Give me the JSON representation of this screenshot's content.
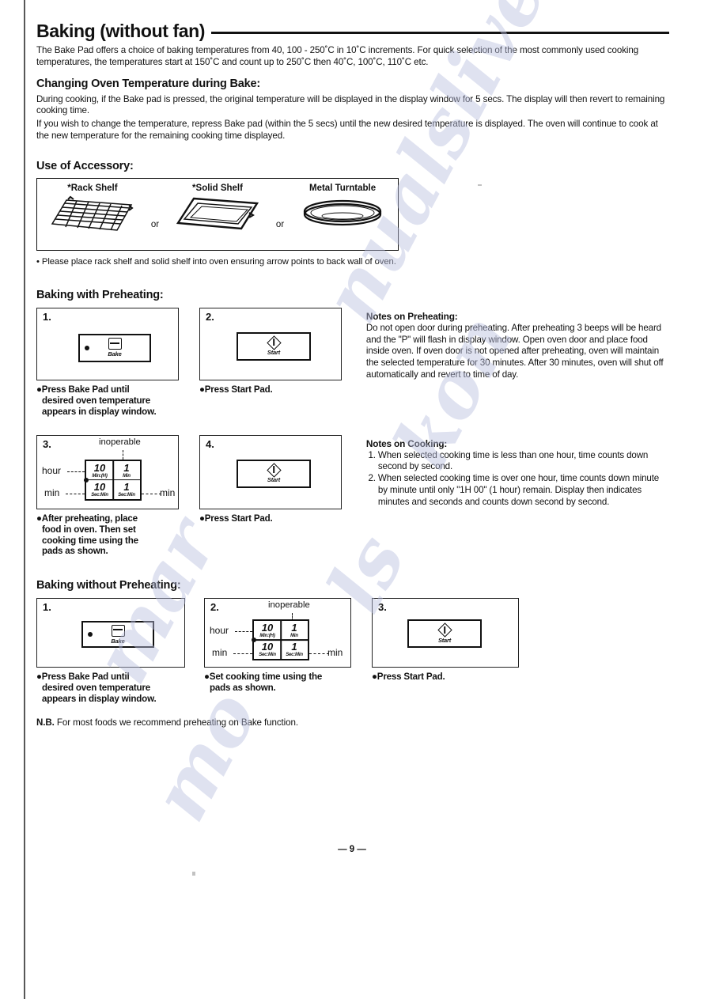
{
  "document": {
    "title": "Baking (without fan)",
    "page_number": "— 9 —"
  },
  "intro": {
    "paragraph": "The Bake Pad offers a choice of baking temperatures from 40, 100 - 250˚C in 10˚C increments. For quick selection of the most commonly used cooking temperatures, the temperatures start at 150˚C and count up to 250˚C then 40˚C, 100˚C, 110˚C etc."
  },
  "changing_temp": {
    "heading": "Changing Oven Temperature during Bake:",
    "paragraph_1": "During cooking, if the Bake pad is pressed, the original temperature will be displayed in the display window for 5 secs. The display will then revert to remaining cooking time.",
    "paragraph_2": "If you wish to change the temperature, repress Bake pad (within the 5 secs) until the new desired temperature is displayed. The oven will continue to cook at the new temperature for the remaining cooking time displayed."
  },
  "accessory": {
    "heading": "Use of Accessory:",
    "items": [
      {
        "label": "*Rack Shelf",
        "icon": "rack-shelf-icon"
      },
      {
        "label": "*Solid Shelf",
        "icon": "solid-shelf-icon"
      },
      {
        "label": "Metal Turntable",
        "icon": "metal-turntable-icon"
      }
    ],
    "separator": "or",
    "footnote": "• Please place rack shelf and solid shelf into oven ensuring arrow points to back wall of oven."
  },
  "with_preheating": {
    "heading": "Baking with Preheating:",
    "steps": [
      {
        "number": "1.",
        "pad": {
          "type": "bake",
          "caption": "Bake",
          "icon": "oven-icon"
        },
        "caption_lines": [
          "●Press Bake Pad until",
          "desired oven temperature",
          "appears in display window."
        ]
      },
      {
        "number": "2.",
        "pad": {
          "type": "start",
          "caption": "Start",
          "icon": "start-diamond-icon"
        },
        "caption_lines": [
          "●Press Start Pad."
        ]
      },
      {
        "number": "3.",
        "pad": {
          "type": "matrix"
        },
        "caption_lines": [
          "●After preheating, place",
          "food in oven. Then set",
          "cooking time using the",
          "pads as shown."
        ]
      },
      {
        "number": "4.",
        "pad": {
          "type": "start",
          "caption": "Start",
          "icon": "start-diamond-icon"
        },
        "caption_lines": [
          "●Press Start Pad."
        ]
      }
    ]
  },
  "time_matrix": {
    "inoperable_label": "inoperable",
    "row_label_top": "hour",
    "row_label_bottom": "min",
    "right_label": "min",
    "cells": [
      {
        "value": "10",
        "sub": "Min:(H)"
      },
      {
        "value": "1",
        "sub": "Min"
      },
      {
        "value": "10",
        "sub": "Sec:Min"
      },
      {
        "value": "1",
        "sub": "Sec:Min"
      }
    ]
  },
  "notes_preheating": {
    "title": "Notes on Preheating:",
    "body": "Do not open door during preheating. After preheating 3 beeps will be heard and the \"P\" will flash in display window. Open oven door and place food inside oven. If oven door is not opened after preheating, oven will maintain the selected temperature for 30 minutes. After 30 minutes, oven will shut off automatically and revert to time of day."
  },
  "notes_cooking": {
    "title": "Notes on Cooking:",
    "items": [
      "When selected cooking time is less than one hour, time counts down second by second.",
      "When selected cooking time is over one hour, time counts down minute by minute until only \"1H 00\" (1 hour) remain. Display then indicates minutes and seconds and counts down second by second."
    ]
  },
  "without_preheating": {
    "heading": "Baking without Preheating:",
    "steps": [
      {
        "number": "1.",
        "pad": {
          "type": "bake",
          "caption": "Bake",
          "icon": "oven-icon"
        },
        "caption_lines": [
          "●Press Bake Pad until",
          "desired oven temperature",
          "appears in display window."
        ]
      },
      {
        "number": "2.",
        "pad": {
          "type": "matrix"
        },
        "caption_lines": [
          "●Set cooking time using the",
          "pads as shown."
        ]
      },
      {
        "number": "3.",
        "pad": {
          "type": "start",
          "caption": "Start",
          "icon": "start-diamond-icon"
        },
        "caption_lines": [
          "●Press Start Pad."
        ]
      }
    ]
  },
  "nb": {
    "prefix": "N.B.",
    "text": " For most foods we recommend preheating on Bake function."
  },
  "watermark": {
    "fragments": [
      "kon",
      "nualslive",
      "mo",
      "mar",
      "ls",
      "al"
    ]
  }
}
